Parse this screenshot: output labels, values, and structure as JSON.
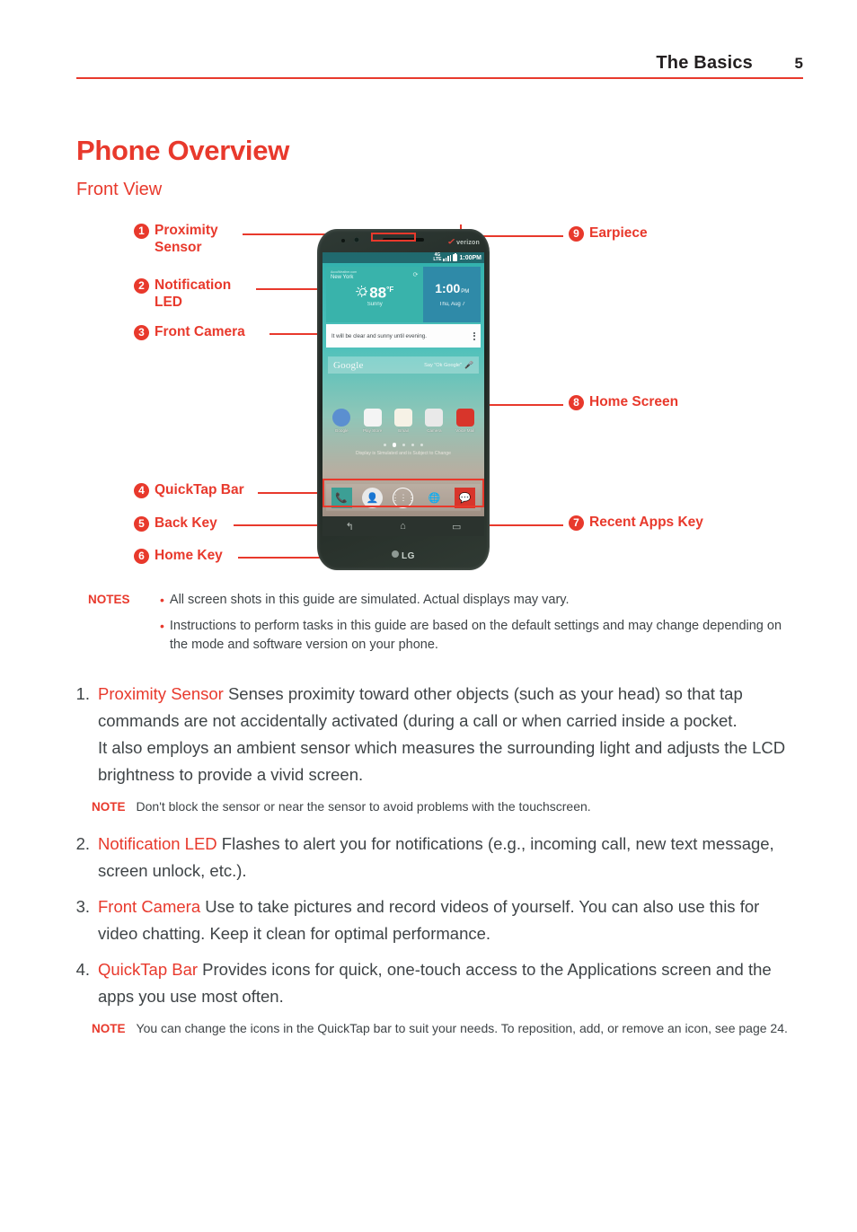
{
  "header": {
    "title": "The Basics",
    "page_number": "5"
  },
  "titles": {
    "main": "Phone Overview",
    "sub": "Front View"
  },
  "callouts": {
    "left": [
      {
        "num": "1",
        "label": "Proximity\nSensor"
      },
      {
        "num": "2",
        "label": "Notification\nLED"
      },
      {
        "num": "3",
        "label": "Front Camera"
      },
      {
        "num": "4",
        "label": "QuickTap Bar"
      },
      {
        "num": "5",
        "label": "Back Key"
      },
      {
        "num": "6",
        "label": "Home Key"
      }
    ],
    "right": [
      {
        "num": "9",
        "label": "Earpiece"
      },
      {
        "num": "8",
        "label": "Home Screen"
      },
      {
        "num": "7",
        "label": "Recent Apps Key"
      }
    ]
  },
  "phone": {
    "carrier": "verizon",
    "statusbar": {
      "network_line1": "4G",
      "network_line2": "LTE",
      "time": "1:00PM"
    },
    "weather_widget": {
      "source": "AccuWeather.com",
      "city": "New York",
      "temperature": "88",
      "degree_unit": "°F",
      "condition": "Sunny",
      "clock_time": "1:00",
      "clock_meridiem": "PM",
      "date": "Thu, Aug 7"
    },
    "forecast_text": "It will be clear and sunny until evening.",
    "google_widget": {
      "logo": "Google",
      "hint": "Say \"Ok Google\""
    },
    "apps": [
      {
        "label": "Google"
      },
      {
        "label": "Play Store"
      },
      {
        "label": "Email"
      },
      {
        "label": "Camera"
      },
      {
        "label": "Voice Mail"
      }
    ],
    "simulation_note": "Display is Simulated and is Subject to Change",
    "quicktap_icons": [
      "phone-icon",
      "contacts-icon",
      "apps-icon",
      "chrome-icon",
      "messaging-icon"
    ],
    "nav_keys": [
      "back-key",
      "home-key",
      "recent-apps-key"
    ],
    "brand": "LG"
  },
  "notes_block": {
    "label": "NOTES",
    "items": [
      "All screen shots in this guide are simulated. Actual displays may vary.",
      "Instructions to perform tasks in this guide are based on the default settings and may change depending on the mode and software version on your phone."
    ]
  },
  "body_list": [
    {
      "index": "1.",
      "keyword": "Proximity Sensor",
      "text": " Senses proximity toward other objects (such as your head) so that tap commands are not accidentally activated (during a call or when carried inside a pocket.",
      "text2": "It also employs an ambient sensor which measures the surrounding light and adjusts the LCD brightness to provide a vivid screen."
    },
    {
      "index": "2.",
      "keyword": "Notification LED",
      "text": " Flashes to alert you for notifications (e.g., incoming call, new text message, screen unlock, etc.)."
    },
    {
      "index": "3.",
      "keyword": "Front Camera",
      "text": " Use to take pictures and record videos of yourself. You can also use this for video chatting. Keep it clean for optimal performance."
    },
    {
      "index": "4.",
      "keyword": "QuickTap Bar",
      "text": " Provides icons for quick, one-touch access to the Applications screen and the apps you use most often."
    }
  ],
  "sub_notes": {
    "note1": {
      "label": "NOTE",
      "text": "Don't block the sensor or near the sensor to avoid problems with the touchscreen."
    },
    "note2": {
      "label": "NOTE",
      "text": "You can change the icons in the QuickTap bar to suit your needs. To reposition, add, or remove an icon, see page 24."
    }
  },
  "colors": {
    "accent": "#e8392c",
    "body_text": "#3f4447"
  }
}
